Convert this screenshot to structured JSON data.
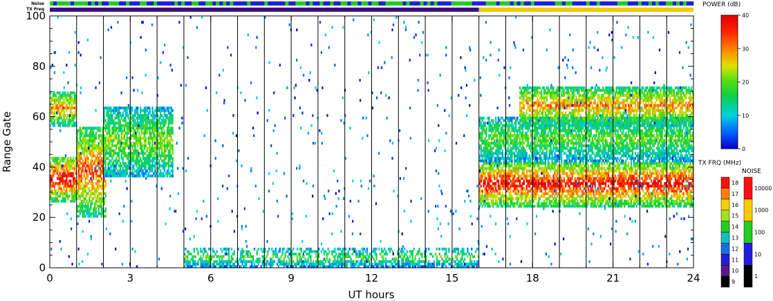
{
  "chart_data": {
    "type": "heatmap",
    "xlabel": "UT hours",
    "ylabel": "Range Gate",
    "xlim": [
      0,
      24
    ],
    "ylim": [
      0,
      100
    ],
    "x_ticks": [
      "0",
      "3",
      "6",
      "9",
      "12",
      "15",
      "18",
      "21",
      "24"
    ],
    "y_ticks": [
      "0",
      "20",
      "40",
      "60",
      "80",
      "100"
    ],
    "top_strips": [
      {
        "label": "Noise",
        "colors": [
          "#1f1fe0",
          "#22cc22"
        ]
      },
      {
        "label": "TX Freq",
        "segments": [
          {
            "from": 0,
            "to": 16,
            "color": "#3b0d82"
          },
          {
            "from": 16,
            "to": 24,
            "color": "#f0c800"
          }
        ]
      }
    ],
    "vertical_lines_ut": [
      1,
      2,
      3,
      4,
      5,
      6,
      7,
      8,
      9,
      10,
      11,
      12,
      13,
      14,
      15,
      16,
      17,
      18,
      19,
      20,
      21,
      22,
      23
    ],
    "power_colorbar": {
      "title": "POWER (dB)",
      "ticks": [
        "0",
        "10",
        "20",
        "30",
        "40"
      ],
      "min": 0,
      "max": 40
    },
    "txfreq_colorbar": {
      "title": "TX FRQ (MHz)",
      "ticks": [
        "9",
        "10",
        "11",
        "12",
        "13",
        "14",
        "15",
        "16",
        "17",
        "18"
      ],
      "colors": [
        "#000000",
        "#5a1a8a",
        "#2020d0",
        "#1a70e0",
        "#10c0c0",
        "#22cc22",
        "#a0e020",
        "#f0d000",
        "#ff8000",
        "#ff1010"
      ]
    },
    "noise_colorbar": {
      "title": "NOISE",
      "ticks": [
        "1",
        "10",
        "100",
        "1000",
        "10000"
      ],
      "colors": [
        "#000000",
        "#1f1fe0",
        "#22cc22",
        "#ffcc00",
        "#ff1010"
      ]
    },
    "echo_regions": [
      {
        "name": "early-band",
        "t0": 0.0,
        "t1": 1.0,
        "g0": 26,
        "g1": 44,
        "peak": 38
      },
      {
        "name": "early-upper",
        "t0": 0.0,
        "t1": 1.0,
        "g0": 56,
        "g1": 70,
        "peak": 30
      },
      {
        "name": "rising-band",
        "t0": 1.0,
        "t1": 2.1,
        "g0": 20,
        "g1": 56,
        "peak": 33
      },
      {
        "name": "tongue",
        "t0": 2.0,
        "t1": 4.6,
        "g0": 36,
        "g1": 64,
        "peak": 22
      },
      {
        "name": "mid-noise-low",
        "t0": 5.0,
        "t1": 16.0,
        "g0": 0,
        "g1": 8,
        "peak": 18
      },
      {
        "name": "late-main-band",
        "t0": 16.0,
        "t1": 24.0,
        "g0": 24,
        "g1": 42,
        "peak": 38
      },
      {
        "name": "late-mid-band",
        "t0": 16.0,
        "t1": 24.0,
        "g0": 42,
        "g1": 60,
        "peak": 20
      },
      {
        "name": "late-upper-band",
        "t0": 17.5,
        "t1": 24.0,
        "g0": 56,
        "g1": 72,
        "peak": 30
      }
    ]
  }
}
